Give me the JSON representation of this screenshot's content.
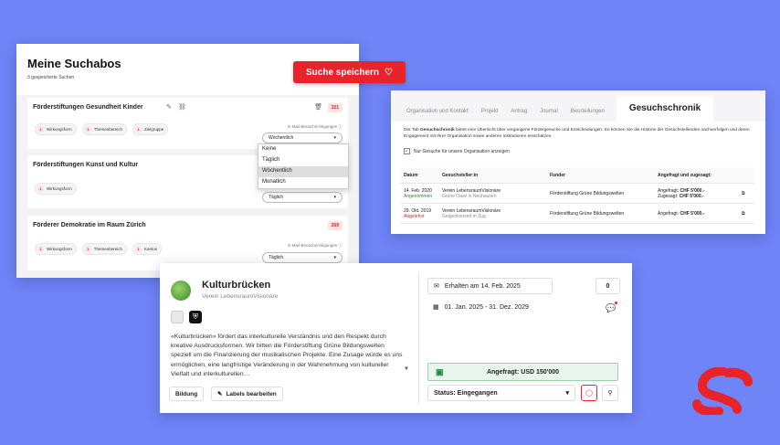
{
  "suchabos": {
    "title": "Meine Suchabos",
    "subtitle": "3 gespeicherte Suchen",
    "save_button": "Suche speichern",
    "cards": [
      {
        "title": "Förderstiftungen Gesundheit Kinder",
        "count": "321",
        "chips": [
          "Wirkungsform",
          "Themenbereich",
          "Zielgruppe"
        ],
        "notif_label": "E-Mail-Benachrichtigungen",
        "frequency": "Wöchentlich"
      },
      {
        "title": "Förderstiftungen Kunst und Kultur",
        "chips": [
          "Wirkungsform"
        ],
        "frequency": "Täglich"
      },
      {
        "title": "Förderer Demokratie im Raum Zürich",
        "count": "269",
        "chips": [
          "Wirkungsform",
          "Themenbereich",
          "Kanton"
        ],
        "notif_label": "E-Mail-Benachrichtigungen",
        "frequency": "Täglich"
      }
    ],
    "chip_number": "1",
    "dropdown_options": [
      "Keine",
      "Täglich",
      "Wöchentlich",
      "Monatlich"
    ],
    "dropdown_selected": "Wöchentlich"
  },
  "chronik": {
    "tabs": [
      "Organisation und Kontakt",
      "Projekt",
      "Antrag",
      "Journal",
      "Beurteilungen",
      "Gesuchschronik"
    ],
    "active_tab": "Gesuchschronik",
    "description_pre": "Der Tab ",
    "description_bold": "Gesuchschronik",
    "description_post": " bietet eine Übersicht über vergangene Fördergesuche und Entscheidungen. So können Sie die Historie der Gesuchstellenden nachverfolgen und deren Engagement mit Ihrer Organisation sowie anderen Institutionen einschätzen.",
    "checkbox_label": "Nur Gesuche für unsere Organisation anzeigen",
    "columns": [
      "Datum",
      "Gesuchsteller:in",
      "Funder",
      "Angefragt und zugesagt:"
    ],
    "rows": [
      {
        "date": "14. Feb. 2020",
        "status": "Angenommen",
        "org": "Verein LebensraumVisionäre",
        "project": "Grüne Oase in Neuhausen",
        "funder": "Förderstiftung Grüne Bildungswelten",
        "req_label": "Angefragt:",
        "req_value": "CHF 5'000.-",
        "grant_label": "Zugesagt:",
        "grant_value": "CHF 5'000.-"
      },
      {
        "date": "29. Okt. 2019",
        "status": "Abgelehnt",
        "org": "Verein LebensraumVisionäre",
        "project": "Geigenkonzert in Zug",
        "funder": "Förderstiftung Grüne Bildungswelten",
        "req_label": "Angefragt:",
        "req_value": "CHF 5'000.-"
      }
    ]
  },
  "kultur": {
    "name": "Kulturbrücken",
    "org": "Verein LebensraumVisionäre",
    "blurb": "«Kulturbrücken» fördert das interkulturelle Verständnis und den Respekt durch kreative Ausdrucksformen. Wir bitten die Förderstiftung Grüne Bildungswelten speziell um die Finanzierung der musikalischen Projekte. Eine Zusage würde es uns ermöglichen, eine langfristige Veränderung in der Wahrnehmung von kultureller Vielfalt und interkulturellen…",
    "tag": "Bildung",
    "labels_button": "Labels bearbeiten",
    "received": "Erhalten am 14. Feb. 2025",
    "count": "0",
    "period": "01. Jan. 2025 - 31. Dez. 2029",
    "requested": "Angefragt: USD 150'000",
    "status": "Status: Eingegangen"
  },
  "colors": {
    "accent": "#e8232a",
    "background": "#6f84f7",
    "green": "#1f8a3b"
  }
}
